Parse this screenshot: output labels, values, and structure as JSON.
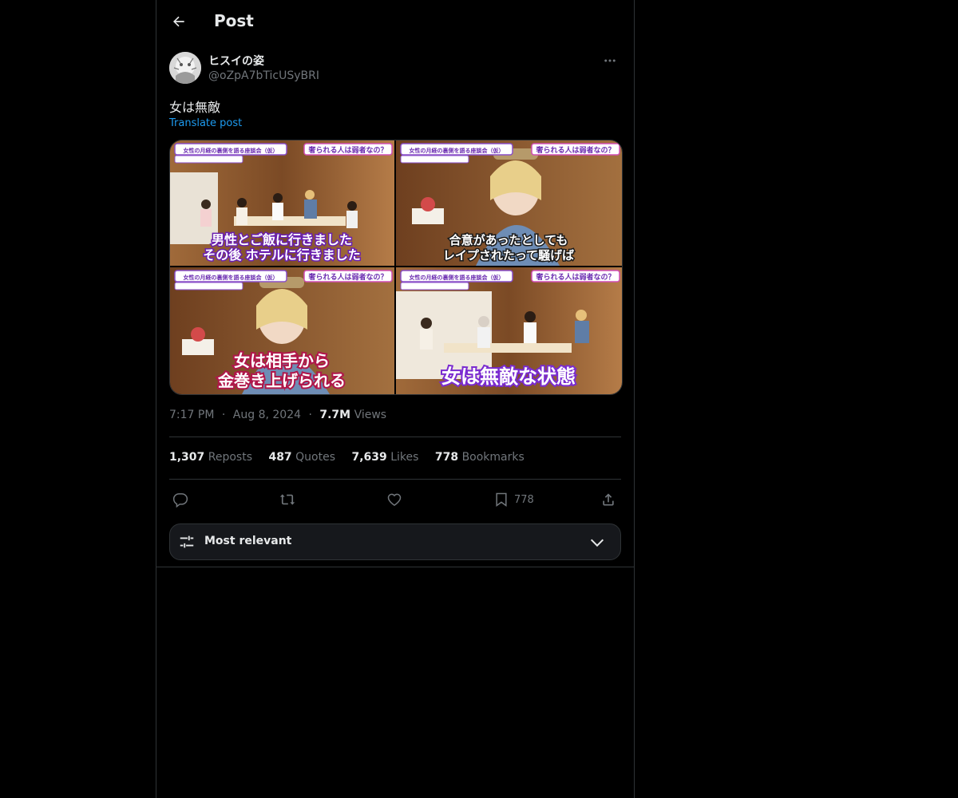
{
  "header": {
    "title": "Post"
  },
  "author": {
    "display_name": "ヒスイの姿",
    "handle": "@oZpA7bTicUSyBRI"
  },
  "post": {
    "text": "女は無敵",
    "translate_label": "Translate post",
    "media": [
      {
        "top_left_caption": "女性の月経の裏側を語る座談会（仮）",
        "top_right_caption": "奢られる人は弱者なの？",
        "subtitle_line1": "男性とご飯に行きました",
        "subtitle_line2": "その後 ホテルに行きました"
      },
      {
        "top_left_caption": "女性の月経の裏側を語る座談会（仮）",
        "top_right_caption": "奢られる人は弱者なの？",
        "subtitle_line1": "合意があったとしても",
        "subtitle_line2": "レイプされたって騒げば"
      },
      {
        "top_left_caption": "女性の月経の裏側を語る座談会（仮）",
        "top_right_caption": "奢られる人は弱者なの？",
        "subtitle_line1": "女は相手から",
        "subtitle_line2": "金巻き上げられる"
      },
      {
        "top_left_caption": "女性の月経の裏側を語る座談会（仮）",
        "top_right_caption": "奢られる人は弱者なの？",
        "subtitle_line1": "女は無敵な状態",
        "subtitle_line2": ""
      }
    ]
  },
  "meta": {
    "time": "7:17 PM",
    "sep1": "·",
    "date": "Aug 8, 2024",
    "sep2": "·",
    "views_count": "7.7M",
    "views_label": "Views"
  },
  "stats": {
    "reposts": {
      "count": "1,307",
      "label": "Reposts"
    },
    "quotes": {
      "count": "487",
      "label": "Quotes"
    },
    "likes": {
      "count": "7,639",
      "label": "Likes"
    },
    "bookmarks": {
      "count": "778",
      "label": "Bookmarks"
    }
  },
  "actions": {
    "bookmark_count": "778"
  },
  "sort": {
    "label": "Most relevant"
  },
  "icons": [
    "back-arrow-icon",
    "more-icon",
    "reply-icon",
    "repost-icon",
    "like-icon",
    "bookmark-icon",
    "share-icon",
    "sliders-icon",
    "chevron-down-icon"
  ],
  "colors": {
    "background": "#000000",
    "accent": "#1d9bf0",
    "muted": "#71767b",
    "text": "#e7e9ea",
    "border": "#2f3336"
  }
}
